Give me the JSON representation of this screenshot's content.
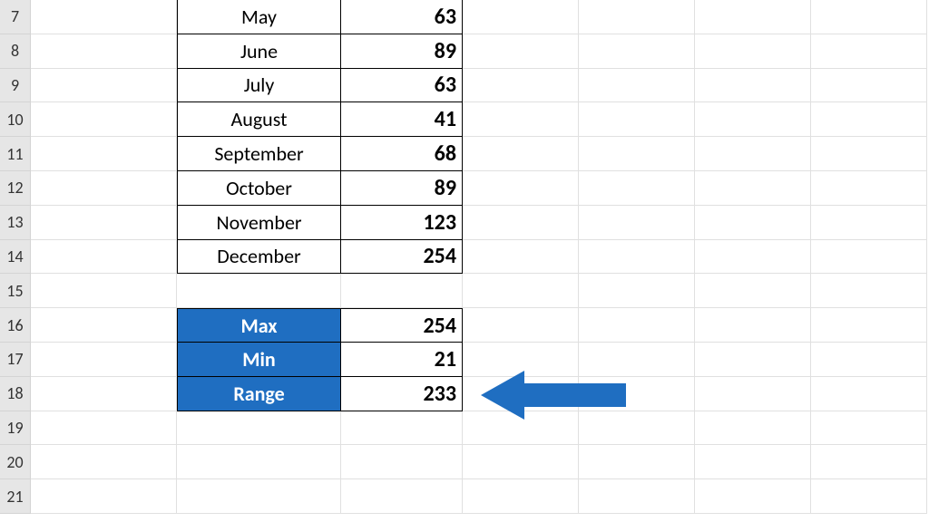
{
  "row_headers": [
    "7",
    "8",
    "9",
    "10",
    "11",
    "12",
    "13",
    "14",
    "15",
    "16",
    "17",
    "18",
    "19",
    "20",
    "21"
  ],
  "months": {
    "r7": {
      "name": "May",
      "value": "63"
    },
    "r8": {
      "name": "June",
      "value": "89"
    },
    "r9": {
      "name": "July",
      "value": "63"
    },
    "r10": {
      "name": "August",
      "value": "41"
    },
    "r11": {
      "name": "September",
      "value": "68"
    },
    "r12": {
      "name": "October",
      "value": "89"
    },
    "r13": {
      "name": "November",
      "value": "123"
    },
    "r14": {
      "name": "December",
      "value": "254"
    }
  },
  "stats": {
    "max": {
      "label": "Max",
      "value": "254"
    },
    "min": {
      "label": "Min",
      "value": "21"
    },
    "range": {
      "label": "Range",
      "value": "233"
    }
  },
  "colors": {
    "header_blue": "#1f6ec1",
    "arrow_blue": "#1f6ec1",
    "row_header_bg": "#e6e6e6"
  }
}
